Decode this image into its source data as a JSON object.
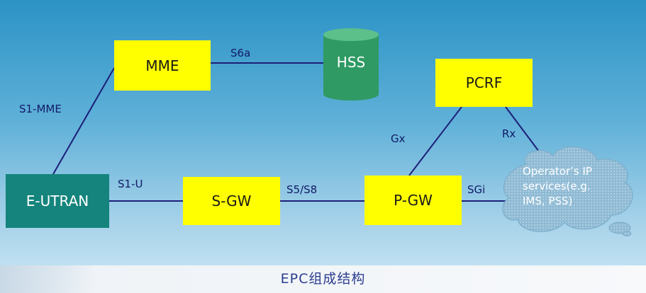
{
  "nodes": {
    "mme": "MME",
    "hss": "HSS",
    "pcrf": "PCRF",
    "eutran": "E-UTRAN",
    "sgw": "S-GW",
    "pgw": "P-GW",
    "operator_services": [
      "Operator’s IP",
      "services(e.g.",
      "IMS, PSS)"
    ]
  },
  "interfaces": {
    "s6a": "S6a",
    "s1_mme": "S1-MME",
    "s1_u": "S1-U",
    "s5_s8": "S5/S8",
    "sgi": "SGi",
    "gx": "Gx",
    "rx": "Rx"
  },
  "caption": "EPC组成结构",
  "colors": {
    "node_fill": "#ffff00",
    "eutran_fill": "#14847c",
    "hss_fill": "#2f9a63",
    "link_color": "#1c1f78",
    "cloud_fill": "#9fc6dd"
  }
}
